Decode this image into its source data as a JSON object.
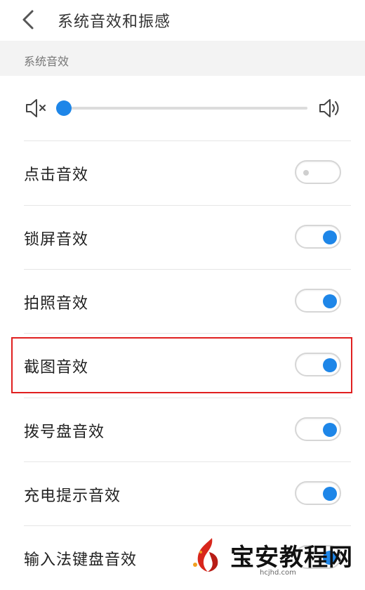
{
  "header": {
    "title": "系统音效和振感",
    "back_icon": "chevron-left-icon"
  },
  "section": {
    "title": "系统音效"
  },
  "volume": {
    "level": 0.02,
    "mute_icon": "volume-mute-icon",
    "loud_icon": "volume-up-icon",
    "accent_color": "#1e86e8"
  },
  "settings": [
    {
      "label": "点击音效",
      "enabled": false
    },
    {
      "label": "锁屏音效",
      "enabled": true
    },
    {
      "label": "拍照音效",
      "enabled": true
    },
    {
      "label": "截图音效",
      "enabled": true
    },
    {
      "label": "拨号盘音效",
      "enabled": true
    },
    {
      "label": "充电提示音效",
      "enabled": true
    },
    {
      "label": "输入法键盘音效",
      "enabled": true
    }
  ],
  "highlight": {
    "target": "截图音效",
    "color": "#e02020"
  },
  "watermark": {
    "text": "宝安教程网",
    "url": "hcjhd.com"
  }
}
